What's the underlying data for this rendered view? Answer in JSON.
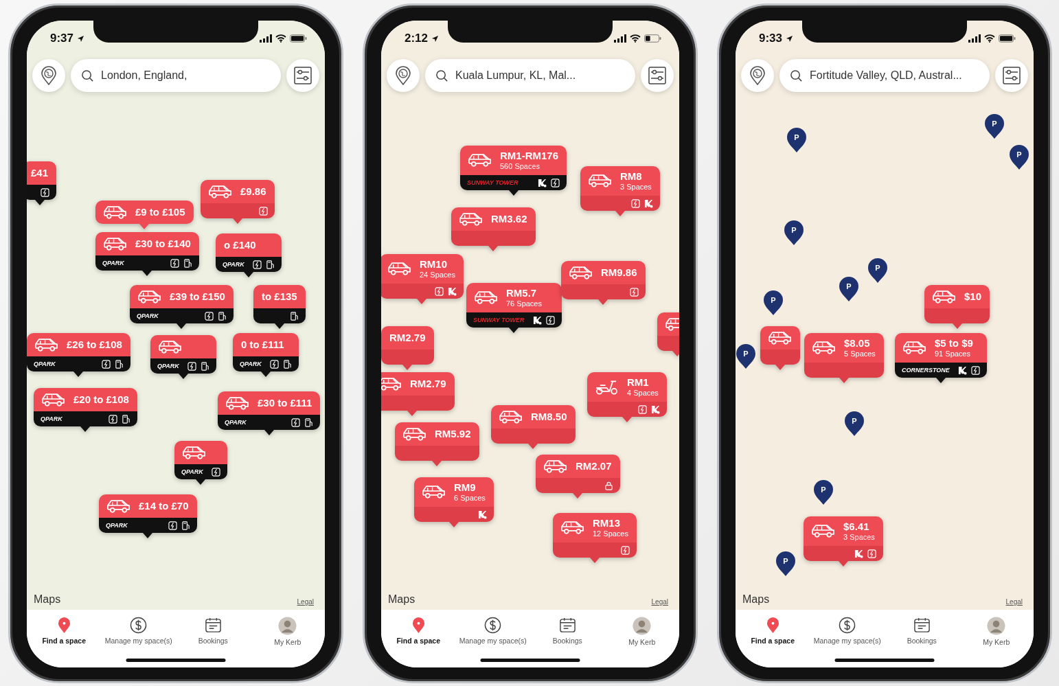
{
  "phones": [
    {
      "status_bar": {
        "time": "9:37"
      },
      "search": {
        "value": "London, England,"
      },
      "pins": [
        {
          "kind": "text",
          "price": "£41",
          "footer": {
            "kind": "dark",
            "features": [
              {
                "kind": "charging"
              }
            ]
          }
        },
        {
          "kind": "car",
          "price": "£9.86",
          "footer": {
            "kind": "red",
            "features": [
              {
                "kind": "charging"
              }
            ]
          }
        },
        {
          "kind": "car",
          "price": "£9 to £105"
        },
        {
          "kind": "car",
          "price": "£30 to £140",
          "footer": {
            "kind": "dark",
            "brand": {
              "text": "QPARK",
              "kind": "light"
            },
            "features": [
              {
                "kind": "charging"
              },
              {
                "kind": "pump"
              }
            ]
          }
        },
        {
          "kind": "text",
          "price": "o £140",
          "footer": {
            "kind": "dark",
            "brand": {
              "text": "QPARK",
              "kind": "light"
            },
            "features": [
              {
                "kind": "charging"
              },
              {
                "kind": "pump"
              }
            ]
          }
        },
        {
          "kind": "text",
          "price": "to £135",
          "footer": {
            "kind": "dark",
            "features": [
              {
                "kind": "pump"
              }
            ]
          }
        },
        {
          "kind": "car",
          "price": "£39 to £150",
          "footer": {
            "kind": "dark",
            "brand": {
              "text": "QPARK",
              "kind": "light"
            },
            "features": [
              {
                "kind": "charging"
              },
              {
                "kind": "pump"
              }
            ]
          }
        },
        {
          "kind": "car",
          "price": "£26 to £108",
          "footer": {
            "kind": "dark",
            "brand": {
              "text": "QPARK",
              "kind": "light"
            },
            "features": [
              {
                "kind": "charging"
              },
              {
                "kind": "pump"
              }
            ]
          }
        },
        {
          "kind": "car",
          "footer": {
            "kind": "dark",
            "brand": {
              "text": "QPARK",
              "kind": "light"
            },
            "features": [
              {
                "kind": "charging"
              },
              {
                "kind": "pump"
              }
            ]
          }
        },
        {
          "kind": "text",
          "price": "0 to £111",
          "footer": {
            "kind": "dark",
            "brand": {
              "text": "QPARK",
              "kind": "light"
            },
            "features": [
              {
                "kind": "charging"
              },
              {
                "kind": "pump"
              }
            ]
          }
        },
        {
          "kind": "car",
          "price": "£20 to £108",
          "footer": {
            "kind": "dark",
            "brand": {
              "text": "QPARK",
              "kind": "light"
            },
            "features": [
              {
                "kind": "charging"
              },
              {
                "kind": "pump"
              }
            ]
          }
        },
        {
          "kind": "car",
          "footer": {
            "kind": "dark",
            "brand": {
              "text": "QPARK",
              "kind": "light"
            },
            "features": [
              {
                "kind": "charging"
              }
            ]
          }
        },
        {
          "kind": "car",
          "price": "£30 to £111",
          "footer": {
            "kind": "dark",
            "brand": {
              "text": "QPARK",
              "kind": "light"
            },
            "features": [
              {
                "kind": "charging"
              },
              {
                "kind": "pump"
              }
            ]
          }
        },
        {
          "kind": "car",
          "price": "£14 to £70",
          "footer": {
            "kind": "dark",
            "brand": {
              "text": "QPARK",
              "kind": "light"
            },
            "features": [
              {
                "kind": "charging"
              },
              {
                "kind": "pump"
              }
            ]
          }
        }
      ],
      "map_attribution": {
        "logo": "Maps",
        "legal": "Legal"
      },
      "tab_bar": [
        {
          "label": "Find a space",
          "kind": "pin",
          "selected": true
        },
        {
          "label": "Manage my space(s)",
          "kind": "dollar",
          "selected": false
        },
        {
          "label": "Bookings",
          "kind": "calendar",
          "selected": false
        },
        {
          "label": "My Kerb",
          "kind": "avatar",
          "selected": false
        }
      ]
    },
    {
      "status_bar": {
        "time": "2:12"
      },
      "search": {
        "value": "Kuala Lumpur, KL, Mal..."
      },
      "pins": [
        {
          "kind": "car",
          "price": "RM8",
          "spaces": "3 Spaces",
          "footer": {
            "kind": "red",
            "features": [
              {
                "kind": "charging"
              },
              {
                "kind": "kerb"
              }
            ]
          }
        },
        {
          "kind": "car",
          "price": "RM1-RM176",
          "spaces": "560 Spaces",
          "footer": {
            "kind": "dark",
            "brand": {
              "text": "SUNWAY TOWER",
              "kind": "red"
            },
            "features": [
              {
                "kind": "kerb"
              },
              {
                "kind": "charging"
              }
            ]
          }
        },
        {
          "kind": "car",
          "price": "RM3.62",
          "footer": {
            "kind": "red"
          }
        },
        {
          "kind": "car",
          "price": "RM10",
          "spaces": "24 Spaces",
          "footer": {
            "kind": "red",
            "features": [
              {
                "kind": "charging"
              },
              {
                "kind": "kerb"
              }
            ]
          }
        },
        {
          "kind": "car",
          "price": "RM5.7",
          "spaces": "76 Spaces",
          "footer": {
            "kind": "dark",
            "brand": {
              "text": "SUNWAY TOWER",
              "kind": "red"
            },
            "features": [
              {
                "kind": "kerb"
              },
              {
                "kind": "charging"
              }
            ]
          }
        },
        {
          "kind": "car",
          "price": "RM9.86",
          "footer": {
            "kind": "red",
            "features": [
              {
                "kind": "charging"
              }
            ]
          }
        },
        {
          "kind": "car",
          "footer": {
            "kind": "red"
          }
        },
        {
          "kind": "text",
          "price": "RM2.79",
          "footer": {
            "kind": "red"
          }
        },
        {
          "kind": "car",
          "price": "RM2.79",
          "footer": {
            "kind": "red"
          }
        },
        {
          "kind": "car",
          "price": "RM5.92",
          "footer": {
            "kind": "red"
          }
        },
        {
          "kind": "scooter",
          "price": "RM1",
          "spaces": "4 Spaces",
          "footer": {
            "kind": "red",
            "features": [
              {
                "kind": "charging"
              },
              {
                "kind": "kerb"
              }
            ]
          }
        },
        {
          "kind": "car",
          "price": "RM8.50",
          "footer": {
            "kind": "red"
          }
        },
        {
          "kind": "car",
          "price": "RM2.07",
          "footer": {
            "kind": "red",
            "features": [
              {
                "kind": "lock"
              }
            ]
          }
        },
        {
          "kind": "car",
          "price": "RM9",
          "spaces": "6 Spaces",
          "footer": {
            "kind": "red",
            "features": [
              {
                "kind": "kerb"
              }
            ]
          }
        },
        {
          "kind": "car",
          "price": "RM13",
          "spaces": "12 Spaces",
          "footer": {
            "kind": "red",
            "features": [
              {
                "kind": "charging"
              }
            ]
          }
        }
      ],
      "map_attribution": {
        "logo": "Maps",
        "legal": "Legal"
      },
      "tab_bar": [
        {
          "label": "Find a space",
          "kind": "pin",
          "selected": true
        },
        {
          "label": "Manage my space(s)",
          "kind": "dollar",
          "selected": false
        },
        {
          "label": "Bookings",
          "kind": "calendar",
          "selected": false
        },
        {
          "label": "My Kerb",
          "kind": "avatar",
          "selected": false
        }
      ]
    },
    {
      "status_bar": {
        "time": "9:33"
      },
      "search": {
        "value": "Fortitude Valley, QLD, Austral..."
      },
      "markers": [
        {
          "label": "P"
        },
        {
          "label": "P"
        },
        {
          "label": "P"
        },
        {
          "label": "P"
        },
        {
          "label": "P"
        },
        {
          "label": "P"
        },
        {
          "label": "P"
        },
        {
          "label": "P"
        },
        {
          "label": "P"
        },
        {
          "label": "P"
        },
        {
          "label": "P"
        }
      ],
      "pins": [
        {
          "kind": "car",
          "footer": {
            "kind": "red"
          }
        },
        {
          "kind": "car",
          "price": "$8.05",
          "spaces": "5 Spaces",
          "footer": {
            "kind": "red"
          }
        },
        {
          "kind": "car",
          "price": "$10",
          "footer": {
            "kind": "red"
          }
        },
        {
          "kind": "car",
          "price": "$5 to $9",
          "spaces": "91 Spaces",
          "footer": {
            "kind": "dark",
            "brand": {
              "text": "CORNERSTONE",
              "kind": "light"
            },
            "features": [
              {
                "kind": "kerb"
              },
              {
                "kind": "charging"
              }
            ]
          }
        },
        {
          "kind": "car",
          "price": "$6.41",
          "spaces": "3 Spaces",
          "footer": {
            "kind": "red",
            "features": [
              {
                "kind": "kerb"
              },
              {
                "kind": "charging"
              }
            ]
          }
        }
      ],
      "map_attribution": {
        "logo": "Maps",
        "legal": "Legal"
      },
      "tab_bar": [
        {
          "label": "Find a space",
          "kind": "pin",
          "selected": true
        },
        {
          "label": "Manage my space(s)",
          "kind": "dollar",
          "selected": false
        },
        {
          "label": "Bookings",
          "kind": "calendar",
          "selected": false
        },
        {
          "label": "My Kerb",
          "kind": "avatar",
          "selected": false
        }
      ]
    }
  ]
}
